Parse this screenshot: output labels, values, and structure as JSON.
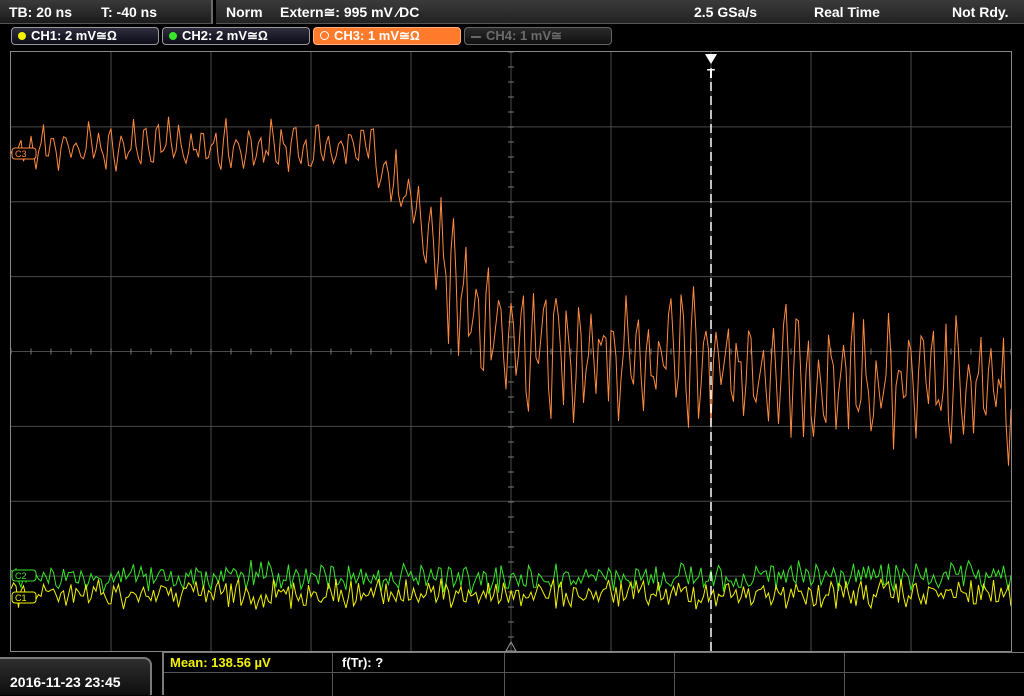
{
  "timebase": {
    "tb": "TB: 20 ns",
    "trigger_time": "T: -40 ns"
  },
  "status": {
    "mode": "Norm",
    "trigger": "Extern≅: 995 mV ∕DC",
    "sample_rate": "2.5 GSa/s",
    "acq": "Real Time",
    "state": "Not Rdy."
  },
  "channels": [
    {
      "label": "CH1: 2 mV≅Ω",
      "color": "#f2f200",
      "active": true
    },
    {
      "label": "CH2: 2 mV≅Ω",
      "color": "#39e62a",
      "active": true
    },
    {
      "label": "CH3: 1 mV≅Ω",
      "color": "#ff7a2a",
      "active": true,
      "selected": true
    },
    {
      "label": "CH4: 1 mV≅",
      "color": "#777777",
      "active": false
    }
  ],
  "markers": {
    "ch3": "C3",
    "ch2": "C2",
    "ch1": "C1",
    "trigger": "T"
  },
  "datetime": "2016-11-23 23:45",
  "measurements": {
    "mean": "Mean: 138.56 µV",
    "ftr": "f(Tr): ?"
  },
  "colors": {
    "ch1": "#f2f200",
    "ch2": "#39e62a",
    "ch3": "#ff8a40",
    "grid": "#4a4a4a"
  },
  "chart_data": {
    "type": "line",
    "title": "",
    "xlabel": "",
    "ylabel": "",
    "grid": true,
    "series": [
      {
        "name": "CH3",
        "note": "noisy step: high then falls to lower level with large oscillation"
      },
      {
        "name": "CH2"
      },
      {
        "name": "CH1"
      }
    ]
  }
}
